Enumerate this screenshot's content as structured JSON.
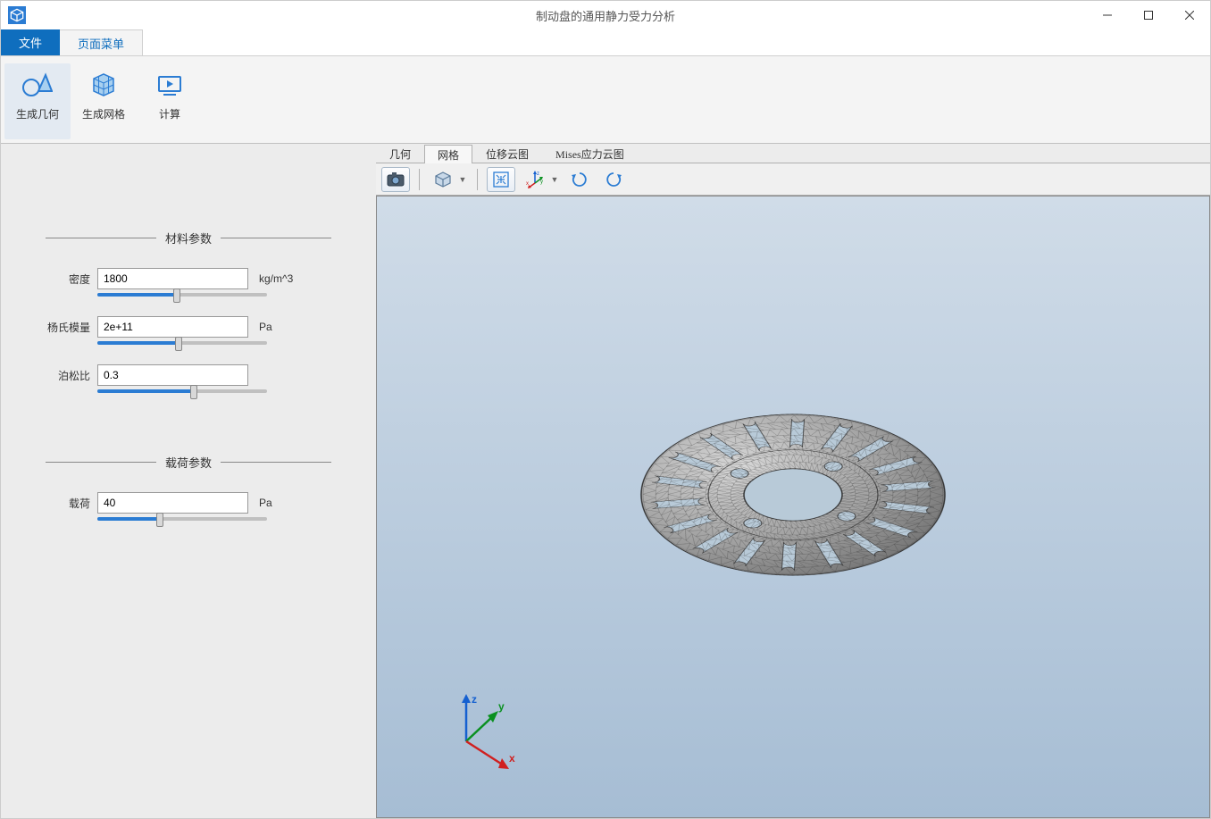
{
  "title": "制动盘的通用静力受力分析",
  "menu": {
    "file": "文件",
    "page": "页面菜单"
  },
  "ribbon": {
    "gen_geom": "生成几何",
    "gen_mesh": "生成网格",
    "compute": "计算"
  },
  "sidebar": {
    "material_section": "材料参数",
    "load_section": "载荷参数",
    "params": {
      "density": {
        "label": "密度",
        "value": "1800",
        "unit": "kg/m^3",
        "slider_pct": 47
      },
      "youngs": {
        "label": "杨氏模量",
        "value": "2e+11",
        "unit": "Pa",
        "slider_pct": 48
      },
      "poisson": {
        "label": "泊松比",
        "value": "0.3",
        "unit": "",
        "slider_pct": 57
      },
      "load": {
        "label": "载荷",
        "value": "40",
        "unit": "Pa",
        "slider_pct": 37
      }
    }
  },
  "view_tabs": {
    "geometry": "几何",
    "mesh": "网格",
    "disp_cloud": "位移云图",
    "mises_cloud": "Mises应力云图"
  },
  "axis": {
    "x": "x",
    "y": "y",
    "z": "z"
  }
}
